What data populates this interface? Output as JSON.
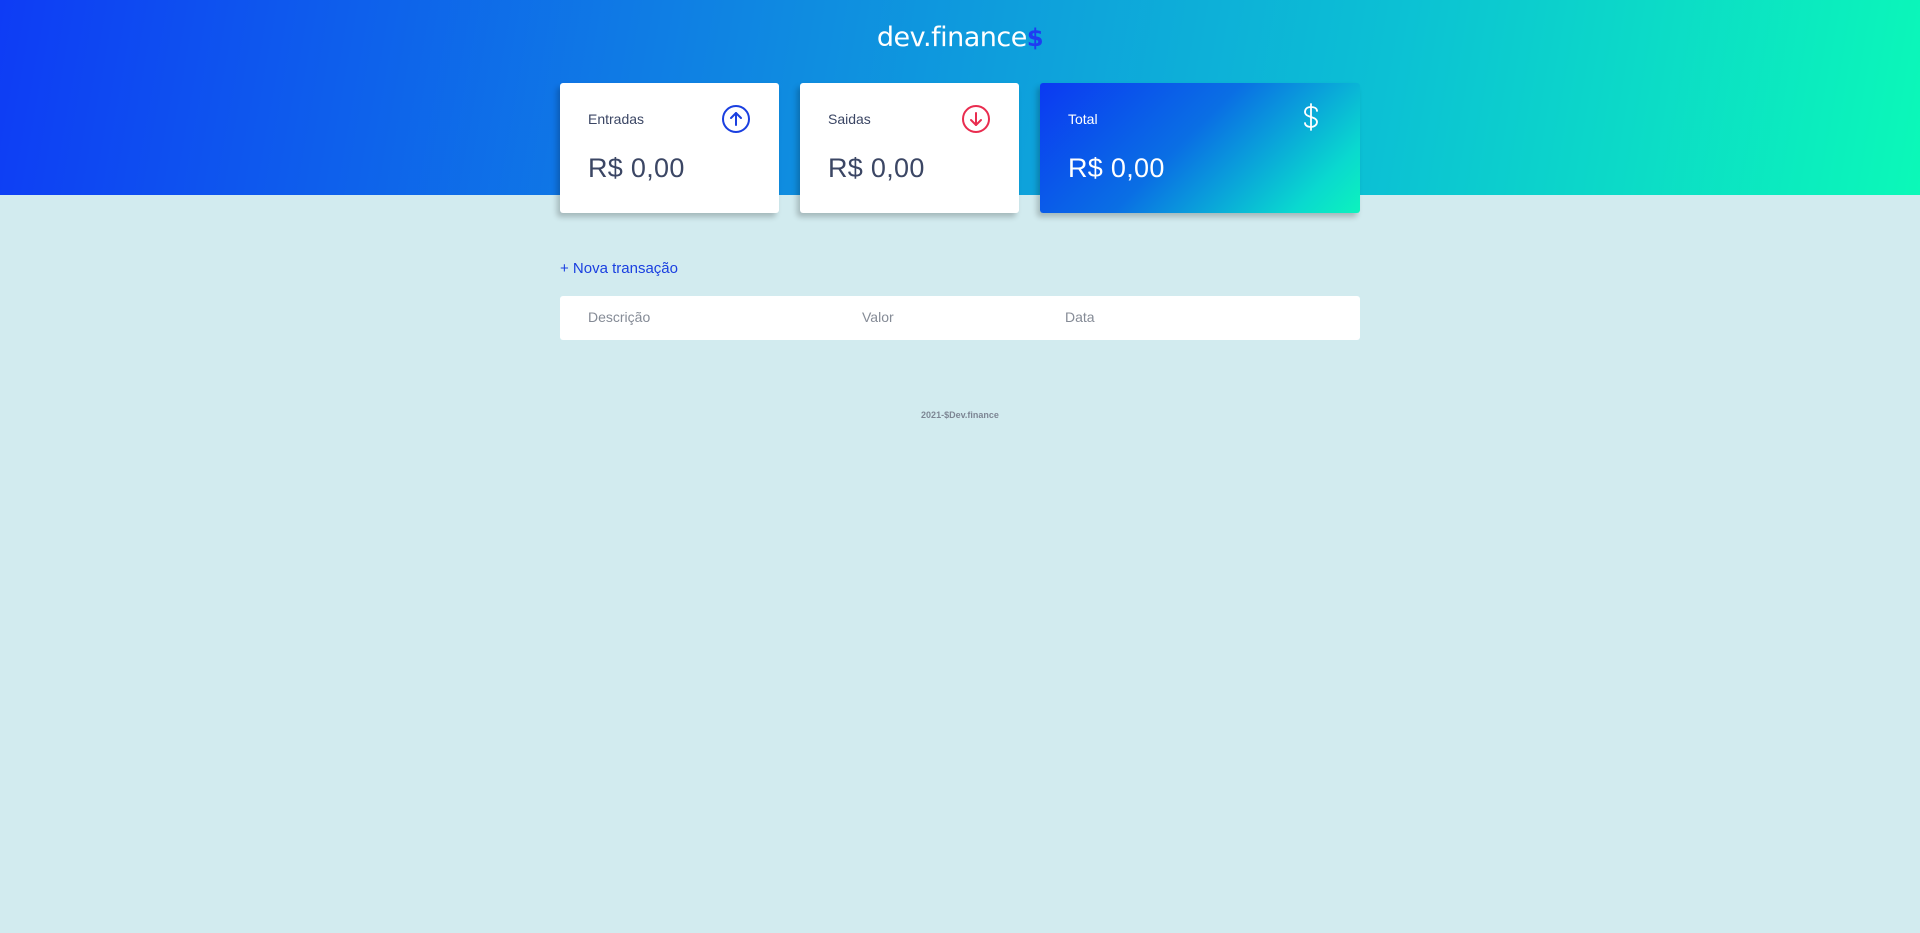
{
  "header": {
    "logo_text": "dev.finance",
    "logo_symbol": "$",
    "gradient": [
      "#0e3cf5",
      "#0f8de0",
      "#0cc1d4",
      "#0bf9b8"
    ]
  },
  "cards": {
    "income": {
      "label": "Entradas",
      "value": "R$ 0,00",
      "icon": "arrow-up-circle-icon",
      "color": "#1a3fe0"
    },
    "expense": {
      "label": "Saidas",
      "value": "R$ 0,00",
      "icon": "arrow-down-circle-icon",
      "color": "#e92c4f"
    },
    "total": {
      "label": "Total",
      "value": "R$ 0,00",
      "icon": "dollar-icon"
    }
  },
  "actions": {
    "new_transaction": "+ Nova transação"
  },
  "table": {
    "columns": [
      "Descrição",
      "Valor",
      "Data"
    ],
    "rows": []
  },
  "footer": {
    "text": "2021-$Dev.finance"
  }
}
